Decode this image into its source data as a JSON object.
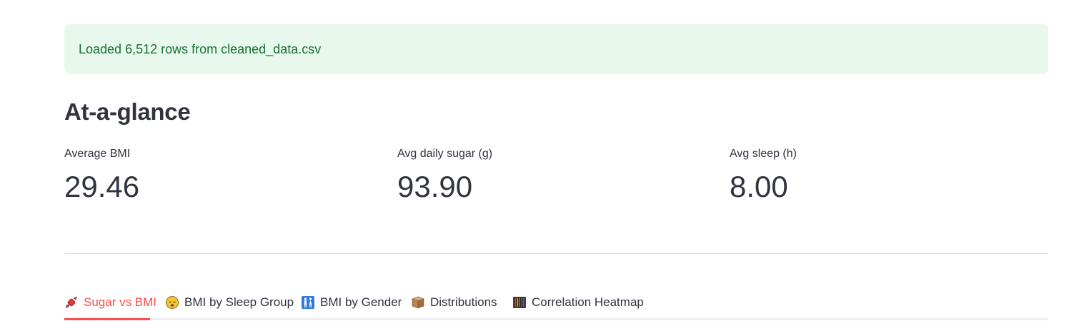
{
  "alert": {
    "message": "Loaded 6,512 rows from cleaned_data.csv"
  },
  "section": {
    "title": "At-a-glance"
  },
  "metrics": [
    {
      "label": "Average BMI",
      "value": "29.46"
    },
    {
      "label": "Avg daily sugar (g)",
      "value": "93.90"
    },
    {
      "label": "Avg sleep (h)",
      "value": "8.00"
    }
  ],
  "tabs": [
    {
      "label": "Sugar vs BMI",
      "icon": "candy-icon",
      "active": true
    },
    {
      "label": "BMI by Sleep Group",
      "icon": "sleeping-face-icon",
      "active": false
    },
    {
      "label": "BMI by Gender",
      "icon": "restroom-icon",
      "active": false
    },
    {
      "label": "Distributions",
      "icon": "box-icon",
      "active": false
    },
    {
      "label": "Correlation Heatmap",
      "icon": "abacus-icon",
      "active": false
    }
  ],
  "colors": {
    "success_bg": "#e8f8ec",
    "success_text": "#177233",
    "accent": "#ff4b4b",
    "text": "#31333f"
  }
}
